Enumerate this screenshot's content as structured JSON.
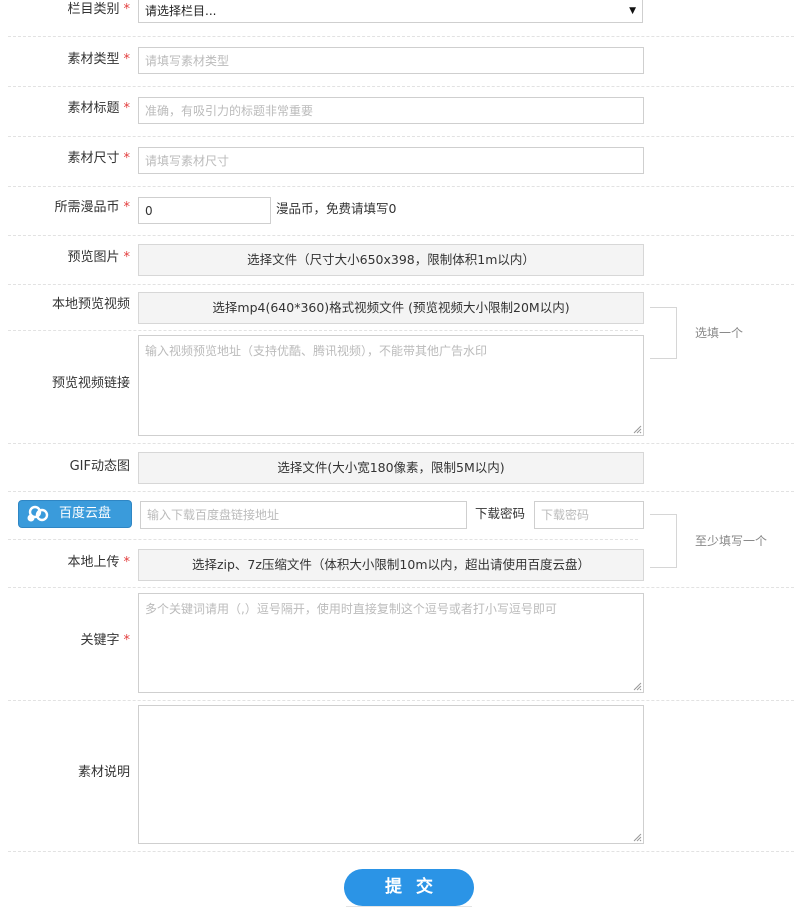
{
  "fields": {
    "category": {
      "label": "栏目类别",
      "value": "请选择栏目..."
    },
    "material_type": {
      "label": "素材类型",
      "placeholder": "请填写素材类型"
    },
    "material_title": {
      "label": "素材标题",
      "placeholder": "准确，有吸引力的标题非常重要"
    },
    "material_size": {
      "label": "素材尺寸",
      "placeholder": "请填写素材尺寸"
    },
    "coins": {
      "label": "所需漫品币",
      "value": "0",
      "hint": "漫品币，免费请填写0"
    },
    "preview_image": {
      "label": "预览图片",
      "button": "选择文件（尺寸大小650x398，限制体积1m以内）"
    },
    "local_video": {
      "label": "本地预览视频",
      "button": "选择mp4(640*360)格式视频文件 (预览视频大小限制20M以内)"
    },
    "video_link": {
      "label": "预览视频链接",
      "placeholder": "输入视频预览地址（支持优酷、腾讯视频），不能带其他广告水印"
    },
    "choose_one_note": "选填一个",
    "gif": {
      "label": "GIF动态图",
      "button": "选择文件(大小宽180像素，限制5M以内)"
    },
    "baidu": {
      "button": "百度云盘",
      "placeholder": "输入下载百度盘链接地址",
      "pwd_label": "下载密码",
      "pwd_placeholder": "下载密码"
    },
    "local_upload": {
      "label": "本地上传",
      "button": "选择zip、7z压缩文件（体积大小限制10m以内，超出请使用百度云盘）"
    },
    "at_least_one_note": "至少填写一个",
    "keywords": {
      "label": "关键字",
      "placeholder": "多个关键词请用（,）逗号隔开，使用时直接复制这个逗号或者打小写逗号即可"
    },
    "description": {
      "label": "素材说明"
    },
    "required_mark": "*"
  },
  "submit": {
    "label": "提交"
  },
  "colors": {
    "required": "#e23b3b",
    "accent": "#2b94e6",
    "baidu": "#3a9bdb"
  }
}
